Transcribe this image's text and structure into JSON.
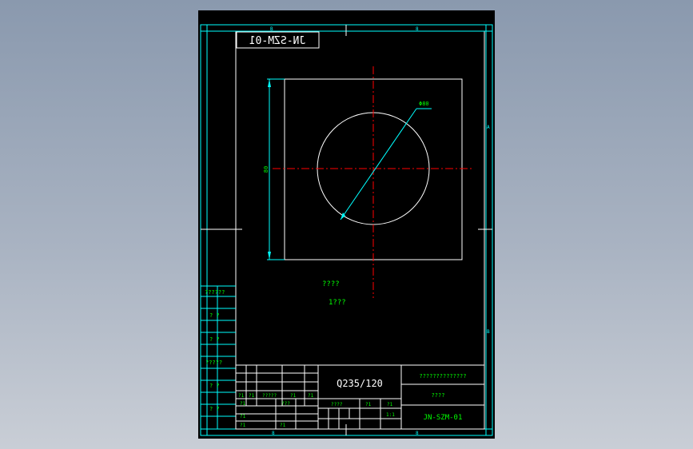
{
  "drawing_number_mirrored": "JN-SZM-01",
  "material": "Q235/120",
  "drawing_number": "JN-SZM-01",
  "title_block": {
    "company": "??????????????",
    "part_name": "????",
    "header_cells": [
      "?1",
      "?1",
      "?????",
      "?1",
      "?1"
    ],
    "row_a": [
      "?1",
      "???"
    ],
    "row_b": [
      "?1"
    ],
    "row_c": [
      "?1",
      "?1"
    ],
    "mid_labels": [
      "????",
      "?1",
      "?1"
    ],
    "scale_label": "1:1"
  },
  "side_labels": [
    "??????",
    "? ?",
    "? ?",
    "?????",
    "? ?",
    "? ?"
  ],
  "zone_labels": {
    "top_left": "B",
    "top_right": "8",
    "right_a": "A",
    "right_b": "B",
    "bottom_left": "8",
    "bottom_right": "8"
  },
  "dimension_labels": {
    "diameter": "Φ80",
    "height": "80"
  },
  "notes": {
    "line1": "????",
    "line2": "1???"
  },
  "colors": {
    "frame": "#00ffff",
    "geometry": "#ffffff",
    "centerline": "#ff0000",
    "dimension": "#00ffff",
    "text": "#00ff00",
    "background": "#000000"
  }
}
